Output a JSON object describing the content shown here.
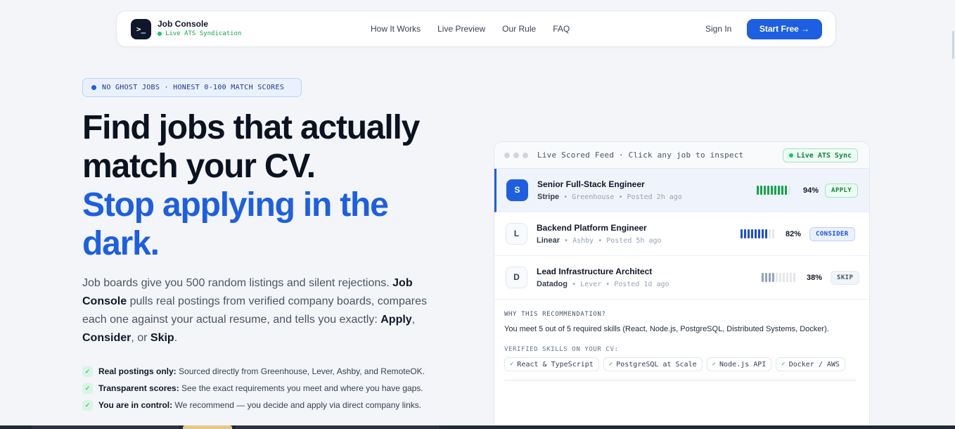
{
  "nav": {
    "brand_icon": ">_",
    "brand_name": "Job Console",
    "brand_sub": "Live ATS Syndication",
    "links": [
      "How It Works",
      "Live Preview",
      "Our Rule",
      "FAQ"
    ],
    "sign_in": "Sign In",
    "start_free": "Start Free →"
  },
  "hero": {
    "badge": "NO GHOST JOBS · HONEST 0-100 MATCH SCORES",
    "headline_dark_1": "Find jobs that actually",
    "headline_dark_2": "match your CV.",
    "headline_blue_1": "Stop applying in the",
    "headline_blue_2": "dark.",
    "lead_1": "Job boards give you 500 random listings and silent rejections. ",
    "lead_2": "Job Console",
    "lead_3": " pulls real postings from verified company boards, compares each one against your actual resume, and tells you exactly: ",
    "lead_4": "Apply",
    "lead_5": ", ",
    "lead_6": "Consider",
    "lead_7": ", or ",
    "lead_8": "Skip",
    "lead_9": ".",
    "checks": [
      {
        "bold": "Real postings only:",
        "text": " Sourced directly from Greenhouse, Lever, Ashby, and RemoteOK."
      },
      {
        "bold": "Transparent scores:",
        "text": " See the exact requirements you meet and where you have gaps."
      },
      {
        "bold": "You are in control:",
        "text": " We recommend — you decide and apply via direct company links."
      }
    ]
  },
  "feed": {
    "title": "Live Scored Feed · Click any job to inspect",
    "ats_pill": "Live ATS Sync",
    "jobs": [
      {
        "initial": "S",
        "title": "Senior Full-Stack Engineer",
        "company": "Stripe",
        "source": "Greenhouse",
        "posted": "Posted 2h ago",
        "score": 94,
        "score_label": "94%",
        "tag": "APPLY"
      },
      {
        "initial": "L",
        "title": "Backend Platform Engineer",
        "company": "Linear",
        "source": "Ashby",
        "posted": "Posted 5h ago",
        "score": 82,
        "score_label": "82%",
        "tag": "CONSIDER"
      },
      {
        "initial": "D",
        "title": "Lead Infrastructure Architect",
        "company": "Datadog",
        "source": "Lever",
        "posted": "Posted 1d ago",
        "score": 38,
        "score_label": "38%",
        "tag": "SKIP"
      }
    ],
    "why_label": "WHY THIS RECOMMENDATION?",
    "why_text": "You meet 5 out of 5 required skills (React, Node.js, PostgreSQL, Distributed Systems, Docker).",
    "skills_label": "VERIFIED SKILLS ON YOUR CV:",
    "skills": [
      "React & TypeScript",
      "PostgreSQL at Scale",
      "Node.js API",
      "Docker / AWS"
    ]
  },
  "colors": {
    "accent": "#1d5fe0",
    "apply": "#16a34a",
    "consider": "#1d4ed8",
    "skip": "#94a3b8"
  }
}
